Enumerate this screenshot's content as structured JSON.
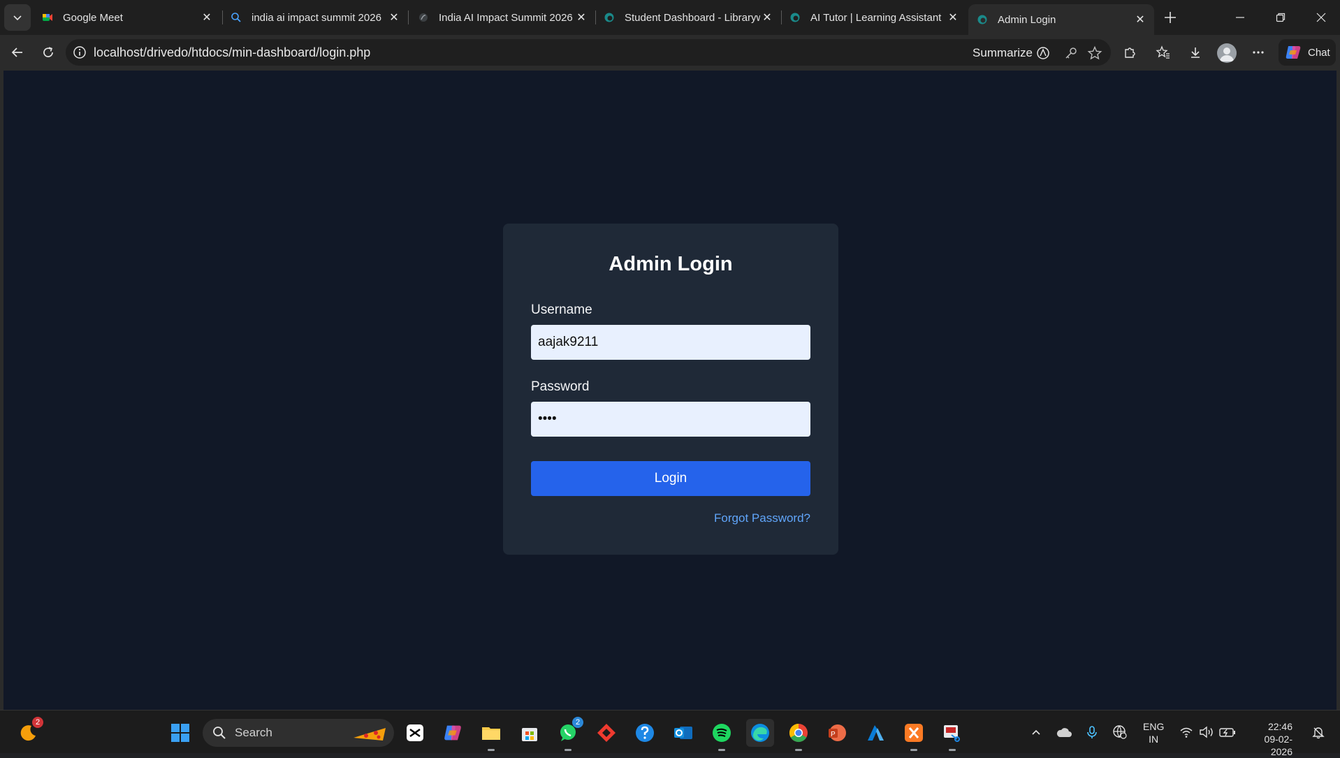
{
  "tabs": [
    {
      "title": "Google Meet",
      "icon": "google-meet-icon"
    },
    {
      "title": "india ai impact summit 2026 ",
      "icon": "search-icon"
    },
    {
      "title": "India AI Impact Summit 2026",
      "icon": "globe-icon"
    },
    {
      "title": "Student Dashboard - Libraryw",
      "icon": "edge-icon"
    },
    {
      "title": "AI Tutor | Learning Assistant",
      "icon": "edge-icon"
    },
    {
      "title": "Admin Login",
      "icon": "edge-icon",
      "active": true
    }
  ],
  "address": {
    "url": "localhost/drivedo/htdocs/min-dashboard/login.php",
    "summarize_label": "Summarize"
  },
  "chat_label": "Chat",
  "login": {
    "title": "Admin Login",
    "username_label": "Username",
    "username_value": "aajak9211",
    "password_label": "Password",
    "password_value": "••••",
    "button_label": "Login",
    "forgot_label": "Forgot Password?"
  },
  "taskbar": {
    "search_label": "Search",
    "weather_badge": "2",
    "whatsapp_badge": "2",
    "lang_line1": "ENG",
    "lang_line2": "IN",
    "time": "22:46",
    "date": "09-02-2026"
  },
  "colors": {
    "page_bg": "#111827",
    "card_bg": "#1f2937",
    "button": "#2563eb",
    "link": "#60a5fa",
    "input_bg": "#e8f0fe"
  }
}
